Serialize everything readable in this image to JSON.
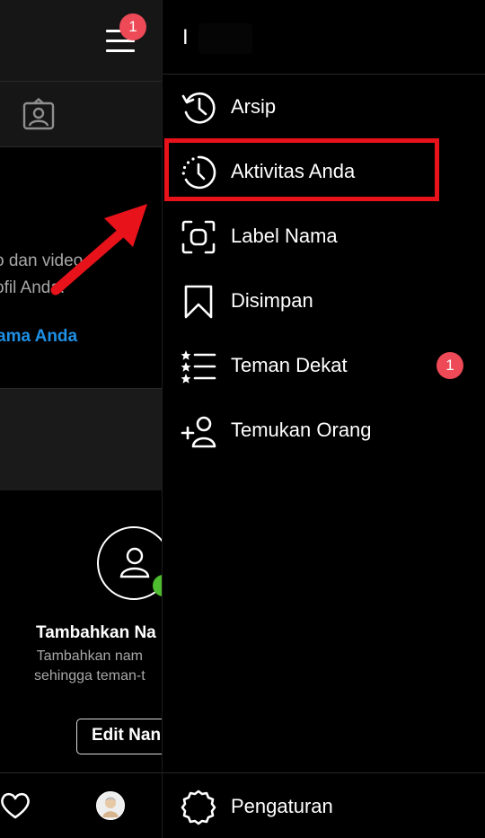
{
  "background_page": {
    "hamburger_badge": "1",
    "empty_state": {
      "description_line1": "o dan video",
      "description_line2": "ofil Anda.",
      "link": "ama Anda"
    },
    "suggestion_card": {
      "title": "Tambahkan Na",
      "text_line1": "Tambahkan nam",
      "text_line2": "sehingga teman-t",
      "button_label": "Edit Nan"
    },
    "bottom_nav": {
      "icons": [
        "heart-icon",
        "profile-avatar"
      ]
    }
  },
  "drawer": {
    "username": "I",
    "menu": [
      {
        "label": "Arsip",
        "icon": "archive-history-icon"
      },
      {
        "label": "Aktivitas Anda",
        "icon": "activity-clock-icon",
        "highlighted": true
      },
      {
        "label": "Label Nama",
        "icon": "nametag-icon"
      },
      {
        "label": "Disimpan",
        "icon": "bookmark-icon"
      },
      {
        "label": "Teman Dekat",
        "icon": "close-friends-icon",
        "badge": "1"
      },
      {
        "label": "Temukan Orang",
        "icon": "add-person-icon"
      }
    ],
    "footer": {
      "label": "Pengaturan",
      "icon": "settings-gear-icon"
    }
  },
  "colors": {
    "highlight": "#e8121a",
    "badge": "#ed4956",
    "link": "#1e90e6",
    "online": "#4dbd2f"
  }
}
